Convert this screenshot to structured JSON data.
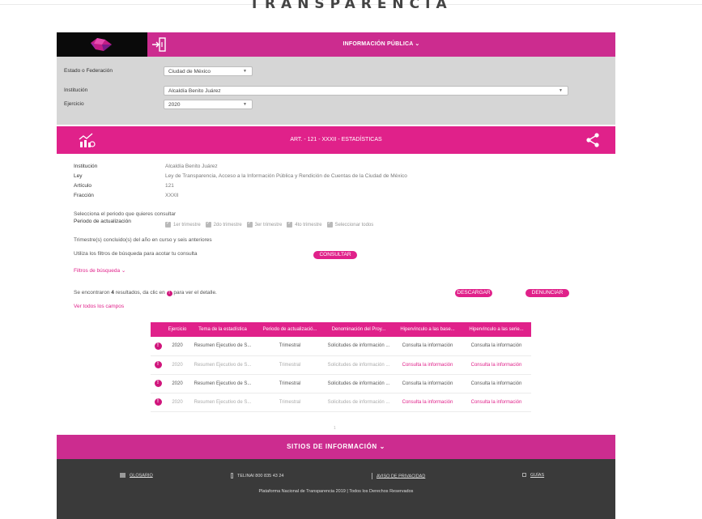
{
  "header": {
    "brand": "TRANSPARENCIA",
    "menu_label": "INFORMACIÓN PÚBLICA ⌄"
  },
  "filters": {
    "state_label": "Estado o Federación",
    "state_value": "Ciudad de México",
    "institution_label": "Institución",
    "institution_value": "Alcaldía Benito Juárez",
    "year_label": "Ejercicio",
    "year_value": "2020"
  },
  "article": {
    "title": "ART. - 121 - XXXII - ESTADÍSTICAS",
    "rows": [
      {
        "label": "Institución",
        "value": "Alcaldía Benito Juárez"
      },
      {
        "label": "Ley",
        "value": "Ley de Transparencia, Acceso a la Información Pública y Rendición de Cuentas de la Ciudad de México"
      },
      {
        "label": "Artículo",
        "value": "121"
      },
      {
        "label": "Fracción",
        "value": "XXXII"
      }
    ]
  },
  "period": {
    "prompt": "Selecciona el periodo que quieres consultar",
    "label": "Periodo de actualización",
    "options": [
      "1er trimestre",
      "2do trimestre",
      "3er trimestre",
      "4to trimestre",
      "Seleccionar todos"
    ],
    "note": "Trimestre(s) concluido(s) del año en curso y seis anteriores"
  },
  "search": {
    "hint": "Utiliza los filtros de búsqueda para acotar tu consulta",
    "consult_button": "CONSULTAR",
    "filters_toggle": "Filtros de búsqueda ⌄"
  },
  "results": {
    "prefix": "Se encontraron ",
    "count": "4",
    "suffix": " resultados, da clic en ",
    "suffix2": " para ver el detalle.",
    "download_button": "DESCARGAR",
    "report_button": "DENUNCIAR",
    "all_fields": "Ver todos los campos"
  },
  "table": {
    "headers": [
      "Ejercicio",
      "Tema de la estadística",
      "Periodo de actualizació...",
      "Denominación del Proy...",
      "Hipervínculo a las base...",
      "Hipervínculo a las serie..."
    ],
    "rows": [
      {
        "year": "2020",
        "topic": "Resumen Ejecutivo de S...",
        "period": "Trimestral",
        "project": "Solicitudes de información ...",
        "link1": "Consulta la información",
        "link2": "Consulta la información"
      },
      {
        "year": "2020",
        "topic": "Resumen Ejecutivo de S...",
        "period": "Trimestral",
        "project": "Solicitudes de información ...",
        "link1": "Consulta la información",
        "link2": "Consulta la información"
      },
      {
        "year": "2020",
        "topic": "Resumen Ejecutivo de S...",
        "period": "Trimestral",
        "project": "Solicitudes de información ...",
        "link1": "Consulta la información",
        "link2": "Consulta la información"
      },
      {
        "year": "2020",
        "topic": "Resumen Ejecutivo de S...",
        "period": "Trimestral",
        "project": "Solicitudes de información ...",
        "link1": "Consulta la información",
        "link2": "Consulta la información"
      }
    ],
    "page": "1"
  },
  "sites": {
    "label": "SITIOS DE INFORMACIÓN ⌄"
  },
  "footer": {
    "glossary": "GLOSARIO",
    "phone": "TELINAI 800 835 43 24",
    "privacy": "AVISO DE PRIVACIDAD",
    "guides": "GUÍAS",
    "copyright": "Plataforma Nacional de Transparencia 2019 | Todos los Derechos Reservados"
  },
  "colors": {
    "brand_pink": "#e0218a",
    "nav_pink": "#cc2c8f",
    "filter_gray": "#d6d6d6",
    "footer_dark": "#3a3a3a"
  }
}
